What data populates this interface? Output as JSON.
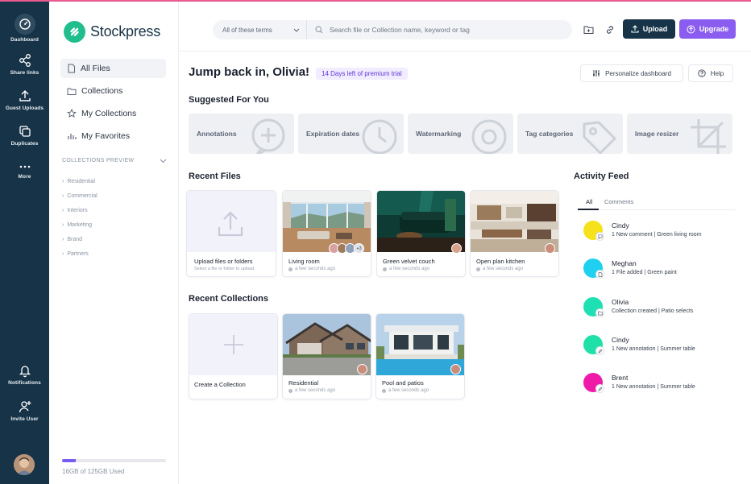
{
  "rail": {
    "items": [
      {
        "label": "Dashboard",
        "icon": "dashboard-icon"
      },
      {
        "label": "Share links",
        "icon": "share-icon"
      },
      {
        "label": "Guest Uploads",
        "icon": "upload-icon"
      },
      {
        "label": "Duplicates",
        "icon": "duplicates-icon"
      },
      {
        "label": "More",
        "icon": "more-icon"
      }
    ],
    "bottom": [
      {
        "label": "Notifications",
        "icon": "bell-icon"
      },
      {
        "label": "Invite User",
        "icon": "add-user-icon"
      }
    ]
  },
  "brand": {
    "name": "Stockpress",
    "color": "#1fbe8c"
  },
  "sidebar": {
    "nav": [
      {
        "label": "All Files",
        "icon": "file-icon"
      },
      {
        "label": "Collections",
        "icon": "folder-icon"
      },
      {
        "label": "My Collections",
        "icon": "star-icon"
      },
      {
        "label": "My Favorites",
        "icon": "chart-icon"
      }
    ],
    "collections_preview_title": "COLLECTIONS PREVIEW",
    "collections_preview": [
      "Residential",
      "Commercial",
      "Interiors",
      "Marketing",
      "Brand",
      "Partners"
    ],
    "storage": {
      "text": "16GB of 125GB Used",
      "used_fraction": 0.128
    }
  },
  "topbar": {
    "search_mode": "All of these terms",
    "search_placeholder": "Search file or Collection name, keyword or tag",
    "upload_label": "Upload",
    "upgrade_label": "Upgrade"
  },
  "main": {
    "greeting": "Jump back in, Olivia!",
    "trial_badge": "14 Days left of premium trial",
    "personalize_label": "Personalize dashboard",
    "help_label": "Help",
    "suggested_title": "Suggested For You",
    "suggested": [
      "Annotations",
      "Expiration dates",
      "Watermarking",
      "Tag categories",
      "Image resizer"
    ],
    "recent_files_title": "Recent Files",
    "upload_card": {
      "title": "Upload files or folders",
      "subtitle": "Select a file or folder to upload"
    },
    "recent_files": [
      {
        "name": "Living room",
        "meta": "a few seconds ago",
        "extra_count": "+3"
      },
      {
        "name": "Green velvet couch",
        "meta": "a few seconds ago"
      },
      {
        "name": "Open plan kitchen",
        "meta": "a few seconds ago"
      }
    ],
    "recent_collections_title": "Recent Collections",
    "create_collection_label": "Create a Collection",
    "recent_collections": [
      {
        "name": "Residential",
        "meta": "a few seconds ago"
      },
      {
        "name": "Pool and patios",
        "meta": "a few seconds ago"
      }
    ]
  },
  "activity": {
    "title": "Activity Feed",
    "tabs": [
      "All",
      "Comments"
    ],
    "items": [
      {
        "name": "Cindy",
        "desc": "1 New comment | Green living room",
        "color": "#f5e21a"
      },
      {
        "name": "Meghan",
        "desc": "1 File added | Green paint",
        "color": "#1fd0f0"
      },
      {
        "name": "Olivia",
        "desc": "Collection created | Patio selects",
        "color": "#1fe0b2"
      },
      {
        "name": "Cindy",
        "desc": "1 New annotation | Summer table",
        "color": "#1fe0a8"
      },
      {
        "name": "Brent",
        "desc": "1 New annotation | Summer table",
        "color": "#f01aa8"
      }
    ]
  }
}
